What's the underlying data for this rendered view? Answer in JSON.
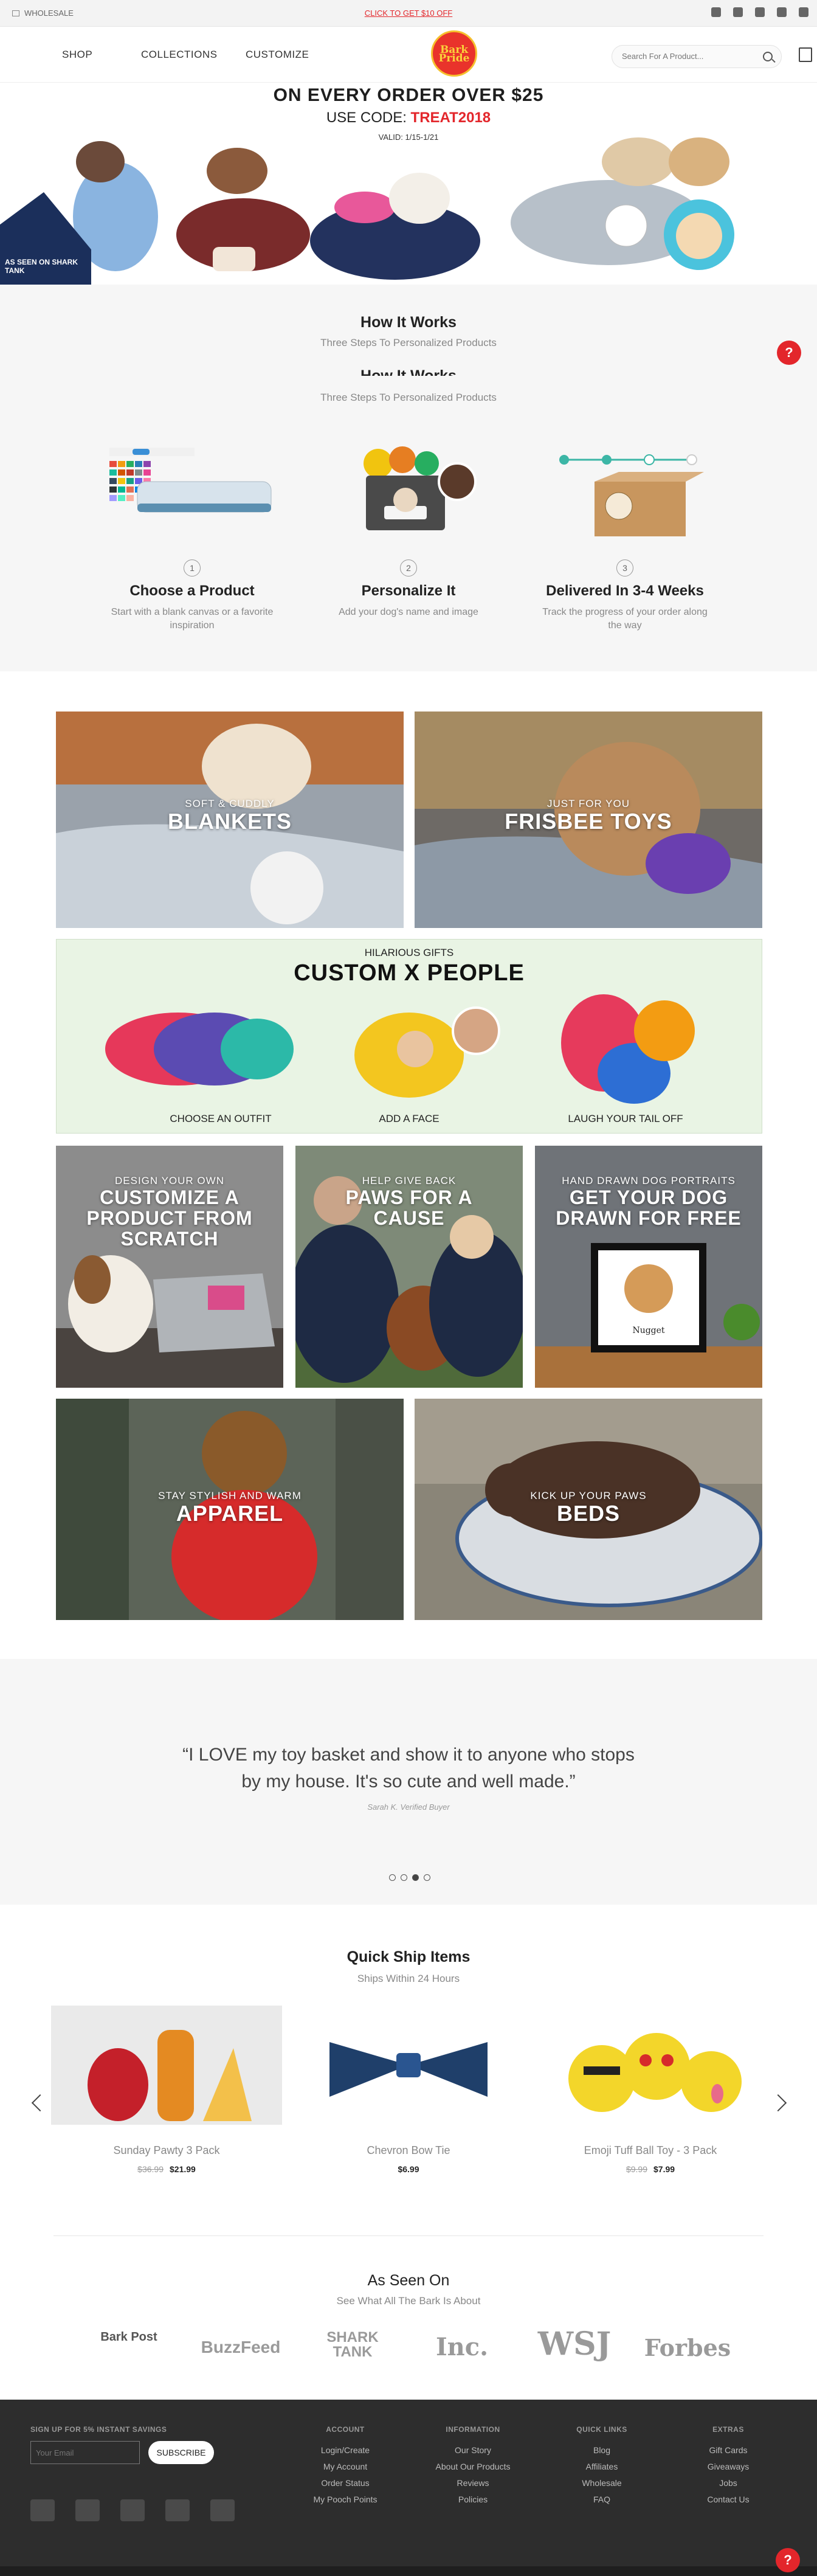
{
  "topbar": {
    "wholesale": "WHOLESALE",
    "promo": "CLICK TO GET $10 OFF"
  },
  "header": {
    "nav": [
      "SHOP",
      "COLLECTIONS",
      "CUSTOMIZE"
    ],
    "logo_text": "Bark Pride",
    "search_placeholder": "Search For A Product..."
  },
  "hero": {
    "headline": "ON EVERY ORDER OVER $25",
    "code_prefix": "USE CODE:",
    "code": "TREAT2018",
    "valid": "VALID: 1/15-1/21",
    "shark": "AS SEEN ON SHARK TANK"
  },
  "how": {
    "title": "How It Works",
    "subtitle": "Three Steps To Personalized Products",
    "steps": [
      {
        "num": "1",
        "title": "Choose a Product",
        "desc": "Start with a blank canvas or a favorite inspiration"
      },
      {
        "num": "2",
        "title": "Personalize It",
        "desc": "Add your dog's name and image"
      },
      {
        "num": "3",
        "title": "Delivered In 3-4 Weeks",
        "desc": "Track the progress of your order along the way"
      }
    ]
  },
  "tiles": {
    "blankets": {
      "kicker": "SOFT & CUDDLY",
      "title": "BLANKETS"
    },
    "frisbee": {
      "kicker": "JUST FOR YOU",
      "title": "FRISBEE TOYS"
    },
    "custom": {
      "kicker": "HILARIOUS GIFTS",
      "title": "CUSTOM X PEOPLE",
      "steps": [
        "CHOOSE AN OUTFIT",
        "ADD A FACE",
        "LAUGH YOUR TAIL OFF"
      ]
    },
    "customize": {
      "kicker": "DESIGN YOUR OWN",
      "title": "CUSTOMIZE A PRODUCT FROM SCRATCH"
    },
    "paws": {
      "kicker": "HELP GIVE BACK",
      "title": "PAWS FOR A CAUSE"
    },
    "portrait": {
      "kicker": "HAND DRAWN DOG PORTRAITS",
      "title": "GET YOUR DOG DRAWN FOR FREE",
      "name": "Nugget"
    },
    "apparel": {
      "kicker": "STAY STYLISH AND WARM",
      "title": "APPAREL"
    },
    "beds": {
      "kicker": "KICK UP YOUR PAWS",
      "title": "BEDS"
    }
  },
  "testimonial": {
    "quote": "“I LOVE my toy basket and show it to anyone who stops by my house. It's so cute and well made.”",
    "author": "Sarah K. Verified Buyer"
  },
  "quickship": {
    "title": "Quick Ship Items",
    "subtitle": "Ships Within 24 Hours",
    "products": [
      {
        "name": "Sunday Pawty 3 Pack",
        "old": "$36.99",
        "price": "$21.99"
      },
      {
        "name": "Chevron Bow Tie",
        "old": "",
        "price": "$6.99"
      },
      {
        "name": "Emoji Tuff Ball Toy - 3 Pack",
        "old": "$9.99",
        "price": "$7.99"
      }
    ]
  },
  "seen": {
    "title": "As Seen On",
    "subtitle": "See What All The Bark Is About",
    "logos": [
      "Bark Post",
      "BuzzFeed",
      "SHARK TANK",
      "Inc.",
      "WSJ",
      "Forbes"
    ]
  },
  "footer": {
    "signup": "SIGN UP FOR 5% INSTANT SAVINGS",
    "email_placeholder": "Your Email",
    "subscribe": "SUBSCRIBE",
    "columns": [
      {
        "heading": "ACCOUNT",
        "links": [
          "Login/Create",
          "My Account",
          "Order Status",
          "My Pooch Points"
        ]
      },
      {
        "heading": "INFORMATION",
        "links": [
          "Our Story",
          "About Our Products",
          "Reviews",
          "Policies"
        ]
      },
      {
        "heading": "QUICK LINKS",
        "links": [
          "Blog",
          "Affiliates",
          "Wholesale",
          "FAQ"
        ]
      },
      {
        "heading": "EXTRAS",
        "links": [
          "Gift Cards",
          "Giveaways",
          "Jobs",
          "Contact Us"
        ]
      }
    ]
  },
  "colors": {
    "accent": "#e3262b",
    "footer": "#2d2d2d",
    "custx_bg": "#e9f4e4"
  }
}
